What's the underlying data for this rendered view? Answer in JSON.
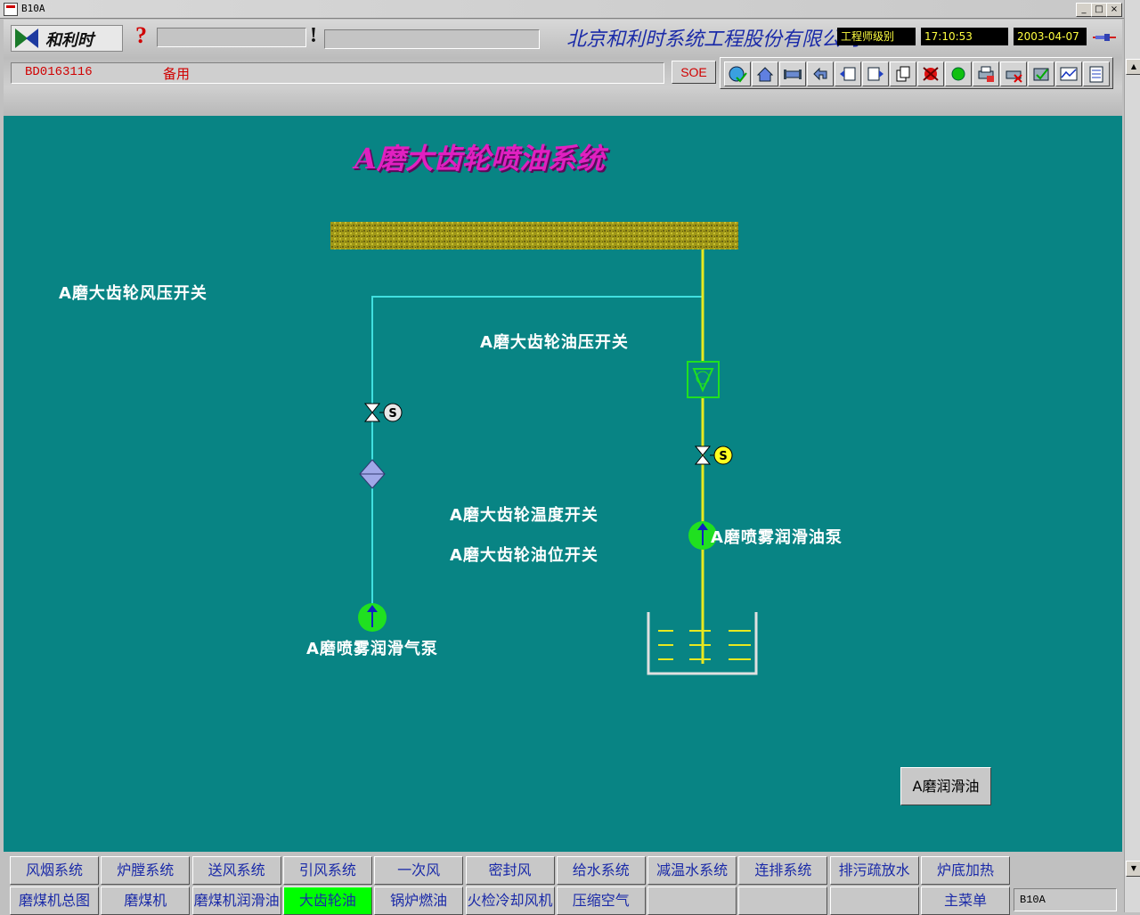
{
  "window": {
    "title": "B10A",
    "min_label": "_",
    "max_label": "□",
    "close_label": "×"
  },
  "header": {
    "logo_text": "和利时",
    "help_mark": "?",
    "alert_mark": "!",
    "company": "北京和利时系统工程股份有限公司",
    "user_level": "工程师级别",
    "time": "17:10:53",
    "date": "2003-04-07",
    "status_id": "BD0163116",
    "status_text": "备用",
    "soe_label": "SOE",
    "toolbar_icons": [
      "globe-check-icon",
      "home-icon",
      "pipe-icon",
      "back-arrow-icon",
      "window-left-icon",
      "window-right-icon",
      "copy-icon",
      "alarm-red-icon",
      "status-green-icon",
      "printer-icon",
      "cancel-icon",
      "refresh-check-icon",
      "trend-icon",
      "report-icon"
    ]
  },
  "diagram": {
    "title": "A磨大齿轮喷油系统",
    "labels": {
      "air_pressure_switch": "A磨大齿轮风压开关",
      "oil_pressure_switch": "A磨大齿轮油压开关",
      "temperature_switch": "A磨大齿轮温度开关",
      "oil_level_switch": "A磨大齿轮油位开关",
      "oil_pump": "A磨喷雾润滑油泵",
      "air_pump": "A磨喷雾润滑气泵"
    },
    "valve_symbol": "S",
    "colors": {
      "background": "#088484",
      "air_line": "#40e0e0",
      "oil_line": "#e8e820",
      "pump": "#20e020",
      "title": "#e020c0"
    },
    "lube_button": "A磨润滑油"
  },
  "nav": {
    "row1": [
      "风烟系统",
      "炉膛系统",
      "送风系统",
      "引风系统",
      "一次风",
      "密封风",
      "给水系统",
      "减温水系统",
      "连排系统",
      "排污疏放水",
      "炉底加热"
    ],
    "row2": [
      "磨煤机总图",
      "磨煤机",
      "磨煤机润滑油",
      "大齿轮油",
      "锅炉燃油",
      "火检冷却风机",
      "压缩空气",
      "",
      "",
      "",
      "主菜单"
    ],
    "active": "大齿轮油",
    "screen_id": "B10A"
  },
  "scrollbar": {
    "up_label": "▲",
    "down_label": "▼"
  }
}
